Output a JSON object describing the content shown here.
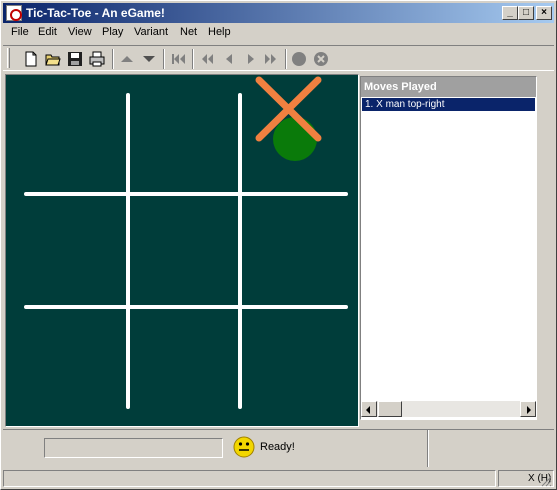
{
  "window": {
    "title": "Tic-Tac-Toe - An eGame!",
    "controls": [
      "minimize",
      "maximize",
      "close"
    ]
  },
  "menu": [
    "File",
    "Edit",
    "View",
    "Play",
    "Variant",
    "Net",
    "Help"
  ],
  "toolbar": {
    "icons": [
      "new-document-icon",
      "open-folder-icon",
      "save-disk-icon",
      "print-icon",
      "move-up-icon",
      "move-down-icon",
      "rewind-icon",
      "first-icon",
      "back-icon",
      "forward-icon",
      "last-icon",
      "record-icon",
      "stop-icon"
    ]
  },
  "board": {
    "background": "#003d3a",
    "grid_color": "#ffffff",
    "pieces": [
      {
        "cell": "top-right",
        "marks": [
          "X",
          "O"
        ],
        "x_color": "#f08040",
        "o_color": "#0a7a0a"
      }
    ]
  },
  "moves_panel": {
    "header": "Moves Played",
    "moves": [
      "1. X man top-right"
    ]
  },
  "status": {
    "text": "Ready!",
    "indicator": "X (H)"
  },
  "colors": {
    "title_bar": "#0a246a",
    "selection": "#0a246a",
    "face": "#d4d0c8"
  }
}
